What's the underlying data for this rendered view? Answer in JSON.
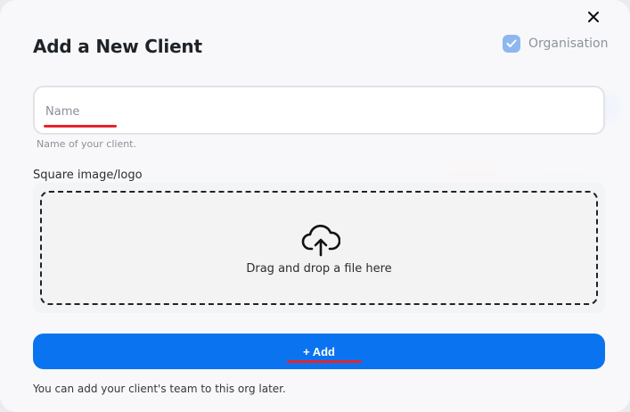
{
  "dialog": {
    "title": "Add a New Client",
    "organisation_label": "Organisation",
    "organisation_checked": true
  },
  "name_field": {
    "placeholder": "Name",
    "value": "",
    "helper": "Name of your client."
  },
  "upload": {
    "label": "Square image/logo",
    "drop_text": "Drag and drop a file here",
    "icon": "cloud-upload-icon"
  },
  "add_button": {
    "label": "+ Add"
  },
  "footer_note": "You can add your client's team to this org later.",
  "colors": {
    "primary": "#0a74f0",
    "checkbox": "#8fb7ef",
    "annotation_red": "#e5242c"
  },
  "icons": {
    "close": "close-icon",
    "check": "check-icon"
  }
}
